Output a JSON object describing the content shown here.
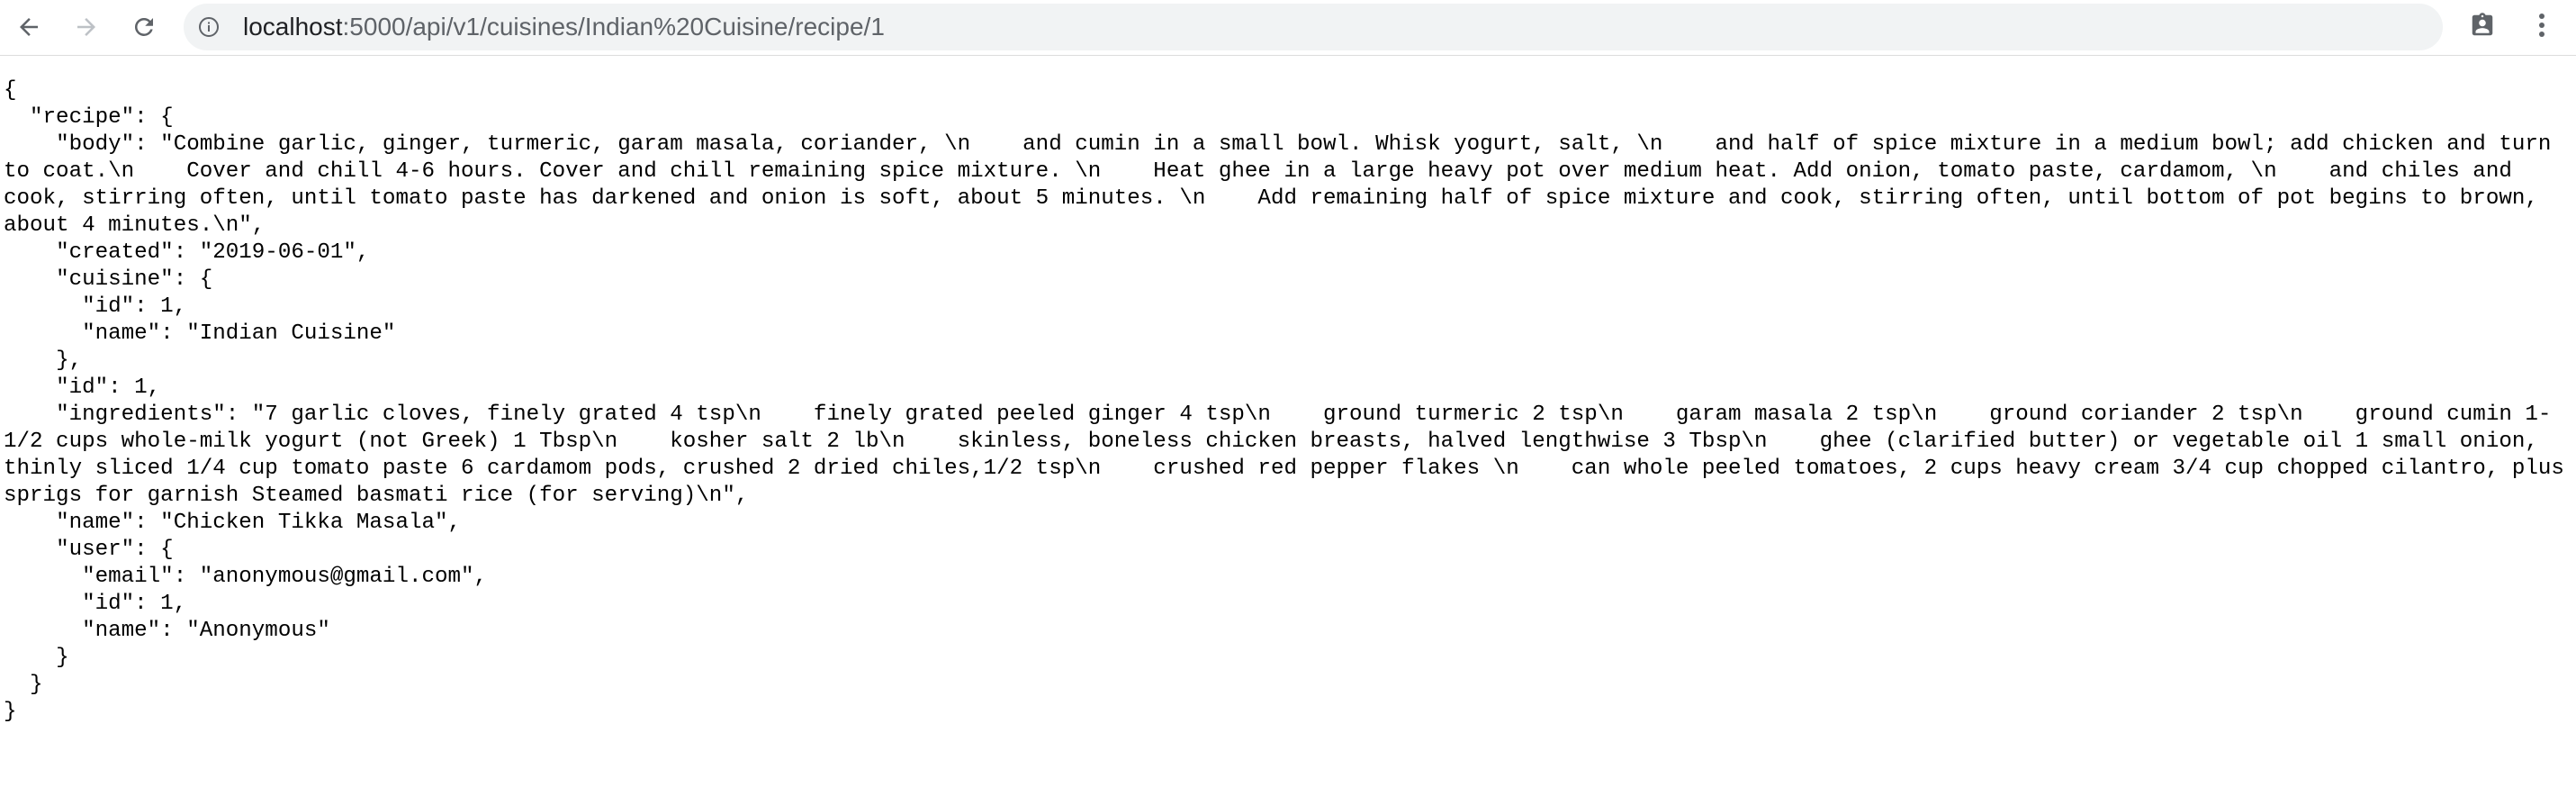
{
  "browser": {
    "url_host": "localhost",
    "url_path": ":5000/api/v1/cuisines/Indian%20Cuisine/recipe/1",
    "icons": {
      "back": "back-arrow-icon",
      "forward": "forward-arrow-icon",
      "reload": "reload-icon",
      "site_info": "info-icon",
      "extension": "clipboard-badge-icon",
      "menu": "kebab-menu-icon"
    }
  },
  "response_json": "{\n  \"recipe\": {\n    \"body\": \"Combine garlic, ginger, turmeric, garam masala, coriander, \\n    and cumin in a small bowl. Whisk yogurt, salt, \\n    and half of spice mixture in a medium bowl; add chicken and turn to coat.\\n    Cover and chill 4-6 hours. Cover and chill remaining spice mixture. \\n    Heat ghee in a large heavy pot over medium heat. Add onion, tomato paste, cardamom, \\n    and chiles and cook, stirring often, until tomato paste has darkened and onion is soft, about 5 minutes. \\n    Add remaining half of spice mixture and cook, stirring often, until bottom of pot begins to brown, about 4 minutes.\\n\",\n    \"created\": \"2019-06-01\",\n    \"cuisine\": {\n      \"id\": 1,\n      \"name\": \"Indian Cuisine\"\n    },\n    \"id\": 1,\n    \"ingredients\": \"7 garlic cloves, finely grated 4 tsp\\n    finely grated peeled ginger 4 tsp\\n    ground turmeric 2 tsp\\n    garam masala 2 tsp\\n    ground coriander 2 tsp\\n    ground cumin 1-1/2 cups whole-milk yogurt (not Greek) 1 Tbsp\\n    kosher salt 2 lb\\n    skinless, boneless chicken breasts, halved lengthwise 3 Tbsp\\n    ghee (clarified butter) or vegetable oil 1 small onion, thinly sliced 1/4 cup tomato paste 6 cardamom pods, crushed 2 dried chiles,1/2 tsp\\n    crushed red pepper flakes \\n    can whole peeled tomatoes, 2 cups heavy cream 3/4 cup chopped cilantro, plus sprigs for garnish Steamed basmati rice (for serving)\\n\",\n    \"name\": \"Chicken Tikka Masala\",\n    \"user\": {\n      \"email\": \"anonymous@gmail.com\",\n      \"id\": 1,\n      \"name\": \"Anonymous\"\n    }\n  }\n}"
}
